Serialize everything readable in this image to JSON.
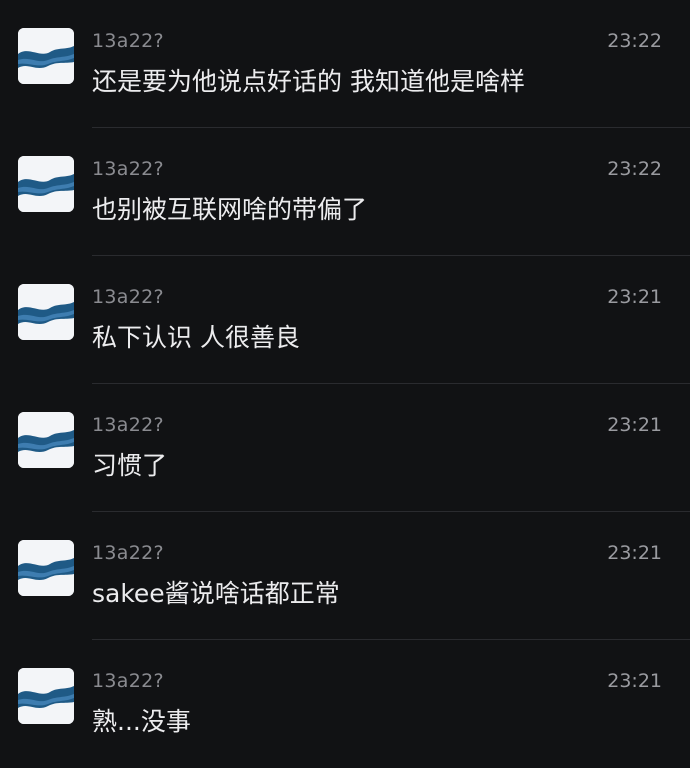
{
  "comments": [
    {
      "username": "13a22?",
      "time": "23:22",
      "text": "还是要为他说点好话的 我知道他是啥样"
    },
    {
      "username": "13a22?",
      "time": "23:22",
      "text": "也别被互联网啥的带偏了"
    },
    {
      "username": "13a22?",
      "time": "23:21",
      "text": "私下认识 人很善良"
    },
    {
      "username": "13a22?",
      "time": "23:21",
      "text": "习惯了"
    },
    {
      "username": "13a22?",
      "time": "23:21",
      "text": "sakee酱说啥话都正常"
    },
    {
      "username": "13a22?",
      "time": "23:21",
      "text": "熟...没事"
    }
  ],
  "avatar_icon": "wave-avatar-icon"
}
